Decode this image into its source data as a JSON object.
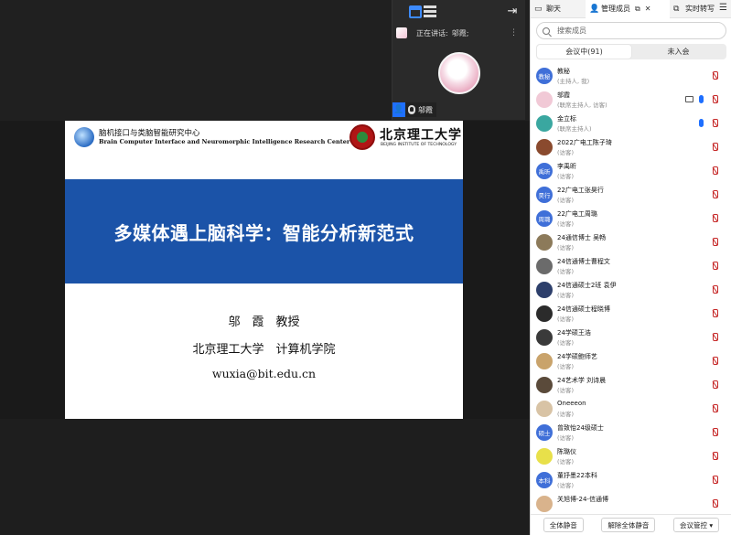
{
  "speaker_panel": {
    "speaking_label": "正在讲话:",
    "speaking_name": "邬霞;",
    "name_tag": "邬霞"
  },
  "slide": {
    "lab_name_cn": "脑机接口与类脑智能研究中心",
    "lab_name_en": "Brain Computer Interface and Neuromorphic Intelligence Research Center",
    "univ_name_cn": "北京理工大学",
    "univ_name_en": "BEIJING INSTITUTE OF TECHNOLOGY",
    "title": "多媒体遇上脑科学：智能分析新范式",
    "author": "邬　霞　教授",
    "affiliation": "北京理工大学　计算机学院",
    "email": "wuxia@bit.edu.cn"
  },
  "panel": {
    "tabs": {
      "chat": "聊天",
      "members": "管理成员",
      "subtitle": "实时转写"
    },
    "search_placeholder": "搜索成员",
    "segments": {
      "in_meeting": "会议中(91)",
      "not_joined": "未入会"
    },
    "members": [
      {
        "name": "教秘",
        "role": "(主持人, 我)",
        "avatar_text": "教秘",
        "avatar_color": "#3f6fd8",
        "cam": false,
        "mic_on": false
      },
      {
        "name": "邬霞",
        "role": "(联席主持人, 访客)",
        "avatar_text": "",
        "avatar_color": "#f1c9d6",
        "cam": true,
        "mic_on": true
      },
      {
        "name": "金立标",
        "role": "(联席主持人)",
        "avatar_text": "",
        "avatar_color": "#3aa7a0",
        "cam": false,
        "mic_on": true
      },
      {
        "name": "2022广电工陈子琦",
        "role": "(访客)",
        "avatar_text": "",
        "avatar_color": "#8a4a2e",
        "cam": false,
        "mic_on": false
      },
      {
        "name": "李禹昕",
        "role": "(访客)",
        "avatar_text": "禹昕",
        "avatar_color": "#3f6fd8",
        "cam": false,
        "mic_on": false
      },
      {
        "name": "22广电工张昊行",
        "role": "(访客)",
        "avatar_text": "昊行",
        "avatar_color": "#3f6fd8",
        "cam": false,
        "mic_on": false
      },
      {
        "name": "22广电工周璐",
        "role": "(访客)",
        "avatar_text": "周璐",
        "avatar_color": "#3f6fd8",
        "cam": false,
        "mic_on": false
      },
      {
        "name": "24通信博士 吴畅",
        "role": "(访客)",
        "avatar_text": "",
        "avatar_color": "#8c7a5a",
        "cam": false,
        "mic_on": false
      },
      {
        "name": "24信通博士曹程文",
        "role": "(访客)",
        "avatar_text": "",
        "avatar_color": "#6b6b6b",
        "cam": false,
        "mic_on": false
      },
      {
        "name": "24信通硕士2班 袁伊",
        "role": "(访客)",
        "avatar_text": "",
        "avatar_color": "#2d3f6b",
        "cam": false,
        "mic_on": false
      },
      {
        "name": "24信通硕士程晓博",
        "role": "(访客)",
        "avatar_text": "",
        "avatar_color": "#2b2b2b",
        "cam": false,
        "mic_on": false
      },
      {
        "name": "24学硕王浩",
        "role": "(访客)",
        "avatar_text": "",
        "avatar_color": "#3a3a3a",
        "cam": false,
        "mic_on": false
      },
      {
        "name": "24学硕鲍师艺",
        "role": "(访客)",
        "avatar_text": "",
        "avatar_color": "#c9a36b",
        "cam": false,
        "mic_on": false
      },
      {
        "name": "24艺术学 刘诗晨",
        "role": "(访客)",
        "avatar_text": "",
        "avatar_color": "#5a4a3a",
        "cam": false,
        "mic_on": false
      },
      {
        "name": "Oneeeon",
        "role": "(访客)",
        "avatar_text": "",
        "avatar_color": "#d8c3a5",
        "cam": false,
        "mic_on": false
      },
      {
        "name": "曾致怡24级硕士",
        "role": "(访客)",
        "avatar_text": "硕士",
        "avatar_color": "#3f6fd8",
        "cam": false,
        "mic_on": false
      },
      {
        "name": "陈璐仪",
        "role": "(访客)",
        "avatar_text": "",
        "avatar_color": "#e8e04a",
        "cam": false,
        "mic_on": false
      },
      {
        "name": "董抒墨22本科",
        "role": "(访客)",
        "avatar_text": "本科",
        "avatar_color": "#3f6fd8",
        "cam": false,
        "mic_on": false
      },
      {
        "name": "关旭博-24-信通博",
        "role": "",
        "avatar_text": "",
        "avatar_color": "#d9b38c",
        "cam": false,
        "mic_on": false
      }
    ],
    "footer": {
      "mute_all": "全体静音",
      "unmute_all": "解除全体静音",
      "meeting_control": "会议管控 ▾"
    }
  },
  "colors": {
    "accent": "#1e6fff",
    "slide_band": "#1b53a8",
    "muted_mic": "#c62828"
  }
}
